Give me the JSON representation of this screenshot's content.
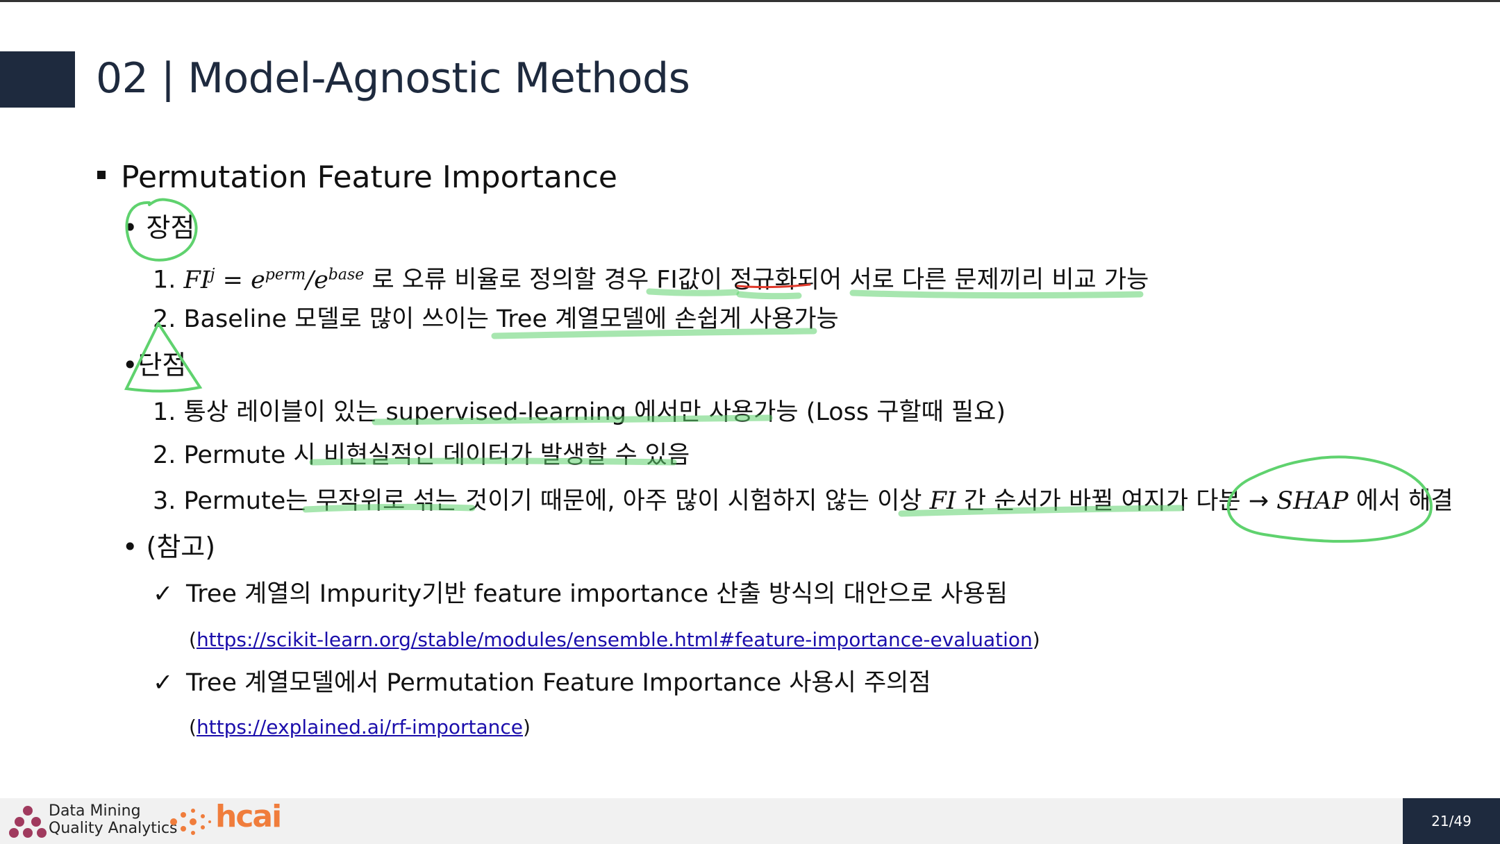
{
  "header": {
    "title": "02 | Model-Agnostic Methods"
  },
  "main": {
    "heading": "Permutation Feature Importance",
    "pros": {
      "label": "장점",
      "items": [
        {
          "number": "1.",
          "formula_main": "FI",
          "formula_sup": "j",
          "formula_eq": " = e",
          "formula_sup2": "perm",
          "formula_slash": "/e",
          "formula_sup3": "base",
          "text": " 로 오류 비율로 정의할 경우 FI값이 정규화되어 서로 다른 문제끼리 비교 가능"
        },
        {
          "number": "2.",
          "text": "Baseline 모델로 많이 쓰이는 Tree 계열모델에 손쉽게 사용가능"
        }
      ]
    },
    "cons": {
      "label": "단점",
      "items": [
        {
          "number": "1.",
          "text": "통상 레이블이 있는 supervised-learning 에서만 사용가능 (Loss 구할때 필요)"
        },
        {
          "number": "2.",
          "text": "Permute 시 비현실적인 데이터가 발생할 수 있음"
        },
        {
          "number": "3.",
          "text_a": "Permute는 무작위로 섞는 것이기 때문에, 아주 많이 시험하지 않는 이상 ",
          "math_fi": "FI",
          "text_b": "   간 순서가 바뀔 여지가 다분 → ",
          "math_shap": "SHAP",
          "text_c": " 에서 해결"
        }
      ]
    },
    "notes": {
      "label": "(참고)",
      "items": [
        {
          "check": "✓",
          "text": "Tree 계열의 Impurity기반 feature importance 산출 방식의 대안으로 사용됨",
          "paren_open": "(",
          "link": "https://scikit-learn.org/stable/modules/ensemble.html#feature-importance-evaluation",
          "paren_close": ")"
        },
        {
          "check": "✓",
          "text": "Tree 계열모델에서 Permutation Feature Importance 사용시 주의점",
          "paren_open": "(",
          "link": "https://explained.ai/rf-importance",
          "paren_close": ")"
        }
      ]
    }
  },
  "footer": {
    "brand_line1": "Data Mining",
    "brand_line2": "Quality Analytics",
    "brand2": "hcai",
    "page": "21/49"
  },
  "colors": {
    "title": "#1e2a3e",
    "highlight_green": "#5fd26e",
    "underline_red": "#e0392b",
    "link": "#1a0dab",
    "hcai_orange": "#f07d3c"
  }
}
